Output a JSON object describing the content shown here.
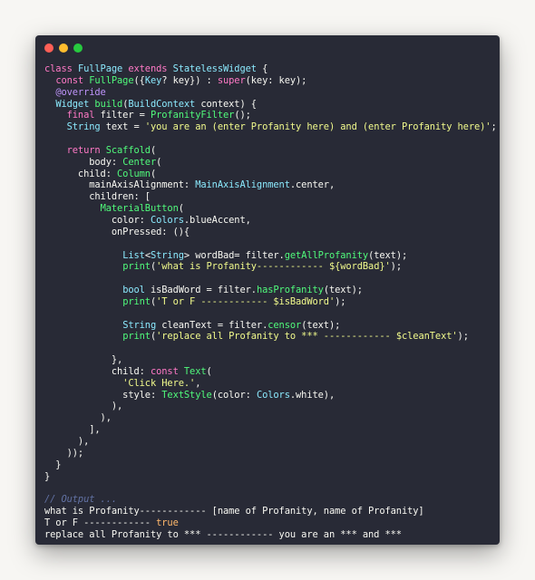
{
  "window_controls": {
    "close_color": "#ff5f56",
    "minimize_color": "#ffbd2e",
    "maximize_color": "#27c93f"
  },
  "code_lines": [
    [
      [
        "kw",
        "class "
      ],
      [
        "ty",
        "FullPage "
      ],
      [
        "kw",
        "extends "
      ],
      [
        "ty",
        "StatelessWidget"
      ],
      [
        "pl",
        " {"
      ]
    ],
    [
      [
        "pl",
        "  "
      ],
      [
        "kw",
        "const "
      ],
      [
        "fn",
        "FullPage"
      ],
      [
        "pl",
        "({"
      ],
      [
        "ty",
        "Key"
      ],
      [
        "pl",
        "? key}) : "
      ],
      [
        "kw",
        "super"
      ],
      [
        "pl",
        "(key: key);"
      ]
    ],
    [
      [
        "pl",
        "  "
      ],
      [
        "an",
        "@override"
      ]
    ],
    [
      [
        "pl",
        "  "
      ],
      [
        "ty",
        "Widget "
      ],
      [
        "fn",
        "build"
      ],
      [
        "pl",
        "("
      ],
      [
        "ty",
        "BuildContext"
      ],
      [
        "pl",
        " context) {"
      ]
    ],
    [
      [
        "pl",
        "    "
      ],
      [
        "kw",
        "final "
      ],
      [
        "pl",
        "filter = "
      ],
      [
        "fn",
        "ProfanityFilter"
      ],
      [
        "pl",
        "();"
      ]
    ],
    [
      [
        "pl",
        "    "
      ],
      [
        "ty",
        "String "
      ],
      [
        "pl",
        "text = "
      ],
      [
        "st",
        "'you are an (enter Profanity here) and (enter Profanity here)'"
      ],
      [
        "pl",
        ";"
      ]
    ],
    [
      [
        "pl",
        ""
      ]
    ],
    [
      [
        "pl",
        "    "
      ],
      [
        "kw",
        "return "
      ],
      [
        "fn",
        "Scaffold"
      ],
      [
        "pl",
        "("
      ]
    ],
    [
      [
        "pl",
        "        body: "
      ],
      [
        "fn",
        "Center"
      ],
      [
        "pl",
        "("
      ]
    ],
    [
      [
        "pl",
        "      child: "
      ],
      [
        "fn",
        "Column"
      ],
      [
        "pl",
        "("
      ]
    ],
    [
      [
        "pl",
        "        mainAxisAlignment: "
      ],
      [
        "ty",
        "MainAxisAlignment"
      ],
      [
        "pl",
        ".center,"
      ]
    ],
    [
      [
        "pl",
        "        children: ["
      ]
    ],
    [
      [
        "pl",
        "          "
      ],
      [
        "fn",
        "MaterialButton"
      ],
      [
        "pl",
        "("
      ]
    ],
    [
      [
        "pl",
        "            color: "
      ],
      [
        "ty",
        "Colors"
      ],
      [
        "pl",
        ".blueAccent,"
      ]
    ],
    [
      [
        "pl",
        "            onPressed: (){"
      ]
    ],
    [
      [
        "pl",
        ""
      ]
    ],
    [
      [
        "pl",
        "              "
      ],
      [
        "ty",
        "List"
      ],
      [
        "pl",
        "<"
      ],
      [
        "ty",
        "String"
      ],
      [
        "pl",
        "> wordBad= filter."
      ],
      [
        "fn",
        "getAllProfanity"
      ],
      [
        "pl",
        "(text);"
      ]
    ],
    [
      [
        "pl",
        "              "
      ],
      [
        "fn",
        "print"
      ],
      [
        "pl",
        "("
      ],
      [
        "st",
        "'what is Profanity------------ ${wordBad}'"
      ],
      [
        "pl",
        ");"
      ]
    ],
    [
      [
        "pl",
        ""
      ]
    ],
    [
      [
        "pl",
        "              "
      ],
      [
        "ty",
        "bool "
      ],
      [
        "pl",
        "isBadWord = filter."
      ],
      [
        "fn",
        "hasProfanity"
      ],
      [
        "pl",
        "(text);"
      ]
    ],
    [
      [
        "pl",
        "              "
      ],
      [
        "fn",
        "print"
      ],
      [
        "pl",
        "("
      ],
      [
        "st",
        "'T or F ------------ $isBadWord'"
      ],
      [
        "pl",
        ");"
      ]
    ],
    [
      [
        "pl",
        ""
      ]
    ],
    [
      [
        "pl",
        "              "
      ],
      [
        "ty",
        "String "
      ],
      [
        "pl",
        "cleanText = filter."
      ],
      [
        "fn",
        "censor"
      ],
      [
        "pl",
        "(text);"
      ]
    ],
    [
      [
        "pl",
        "              "
      ],
      [
        "fn",
        "print"
      ],
      [
        "pl",
        "("
      ],
      [
        "st",
        "'replace all Profanity to *** ------------ $cleanText'"
      ],
      [
        "pl",
        ");"
      ]
    ],
    [
      [
        "pl",
        ""
      ]
    ],
    [
      [
        "pl",
        "            },"
      ]
    ],
    [
      [
        "pl",
        "            child: "
      ],
      [
        "kw",
        "const "
      ],
      [
        "fn",
        "Text"
      ],
      [
        "pl",
        "("
      ]
    ],
    [
      [
        "pl",
        "              "
      ],
      [
        "st",
        "'Click Here.'"
      ],
      [
        "pl",
        ","
      ]
    ],
    [
      [
        "pl",
        "              style: "
      ],
      [
        "fn",
        "TextStyle"
      ],
      [
        "pl",
        "(color: "
      ],
      [
        "ty",
        "Colors"
      ],
      [
        "pl",
        ".white),"
      ]
    ],
    [
      [
        "pl",
        "            ),"
      ]
    ],
    [
      [
        "pl",
        "          ),"
      ]
    ],
    [
      [
        "pl",
        "        ],"
      ]
    ],
    [
      [
        "pl",
        "      ),"
      ]
    ],
    [
      [
        "pl",
        "    ));"
      ]
    ],
    [
      [
        "pl",
        "  }"
      ]
    ],
    [
      [
        "pl",
        "}"
      ]
    ],
    [
      [
        "pl",
        ""
      ]
    ],
    [
      [
        "cm",
        "// Output ..."
      ]
    ],
    [
      [
        "pl",
        "what is Profanity------------ [name of Profanity, name of Profanity]"
      ]
    ],
    [
      [
        "pl",
        "T or F ------------ "
      ],
      [
        "pa",
        "true"
      ]
    ],
    [
      [
        "pl",
        "replace all Profanity to *** ------------ you are an *** and ***"
      ]
    ]
  ]
}
